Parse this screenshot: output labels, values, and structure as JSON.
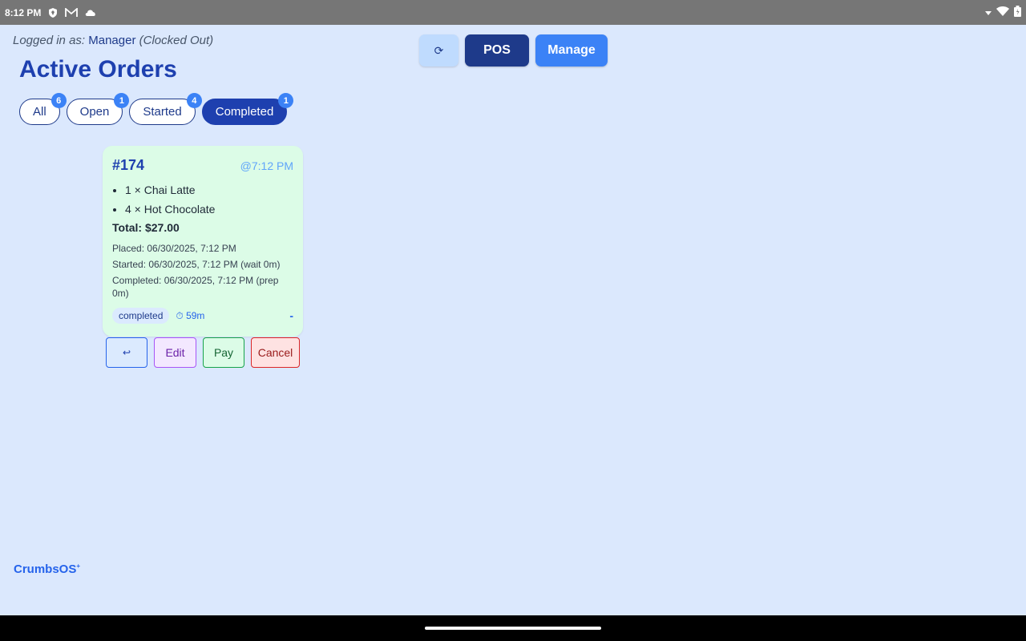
{
  "status_bar": {
    "time": "8:12 PM",
    "icons": [
      "shield-icon",
      "mail-icon",
      "cloud-icon"
    ],
    "right_icons": [
      "signal-icon",
      "wifi-icon",
      "battery-icon"
    ]
  },
  "header": {
    "logged_prefix": "Logged in as:",
    "role": "Manager",
    "clock_status": "(Clocked Out)",
    "refresh_label": "⟳",
    "pos_label": "POS",
    "manage_label": "Manage"
  },
  "page_title": "Active Orders",
  "filters": [
    {
      "label": "All",
      "count": "6"
    },
    {
      "label": "Open",
      "count": "1"
    },
    {
      "label": "Started",
      "count": "4"
    },
    {
      "label": "Completed",
      "count": "1",
      "active": true
    }
  ],
  "order": {
    "number": "#174",
    "time": "@7:12 PM",
    "items": [
      "1 × Chai Latte",
      "4 × Hot Chocolate"
    ],
    "total": "Total: $27.00",
    "placed": "Placed: 06/30/2025, 7:12 PM",
    "started": "Started: 06/30/2025, 7:12 PM (wait 0m)",
    "completed": "Completed: 06/30/2025, 7:12 PM (prep 0m)",
    "status": "completed",
    "elapsed": "⏱ 59m",
    "collapse": "-"
  },
  "actions": {
    "back_label": "↩",
    "edit_label": "Edit",
    "pay_label": "Pay",
    "cancel_label": "Cancel"
  },
  "brand": {
    "name": "CrumbsOS",
    "mark": "+"
  },
  "colors": {
    "background": "#dbe8fd",
    "primary": "#1e40af",
    "accent": "#3b82f6",
    "card": "#dcfce7"
  }
}
